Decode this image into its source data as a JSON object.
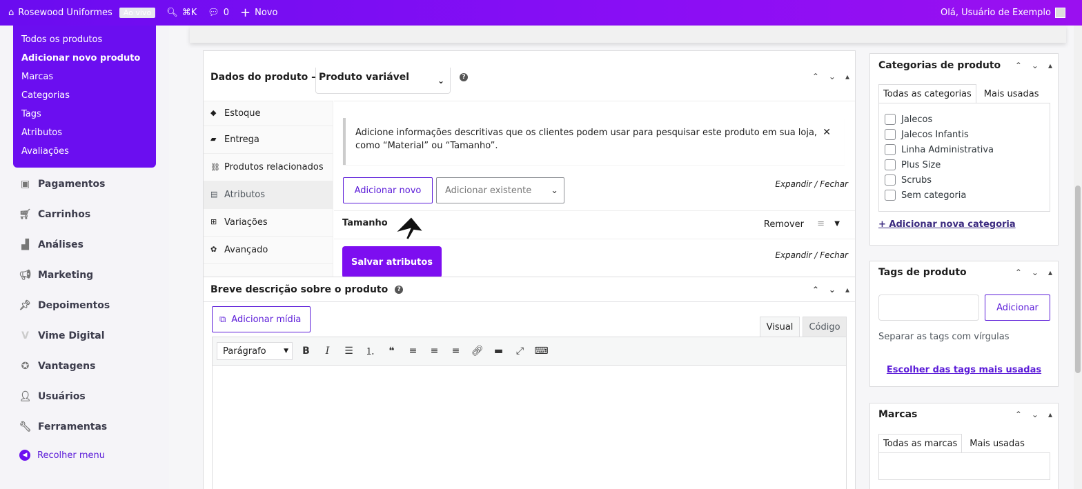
{
  "adminbar": {
    "site_name": "Rosewood Uniformes",
    "live_badge": "Ao vivo",
    "search_shortcut": "⌘K",
    "comments_count": "0",
    "new_label": "Novo",
    "greeting": "Olá, Usuário de Exemplo"
  },
  "sidebar": {
    "submenu": [
      "Todos os produtos",
      "Adicionar novo produto",
      "Marcas",
      "Categorias",
      "Tags",
      "Atributos",
      "Avaliações"
    ],
    "items": [
      {
        "label": "Pagamentos",
        "icon": "payments-icon",
        "glyph": "$"
      },
      {
        "label": "Carrinhos",
        "icon": "cart-icon",
        "glyph": "🛒"
      },
      {
        "label": "Análises",
        "icon": "chart-bar-icon",
        "glyph": "▮"
      },
      {
        "label": "Marketing",
        "icon": "megaphone-icon",
        "glyph": "📢"
      },
      {
        "label": "Depoimentos",
        "icon": "pin-icon",
        "glyph": "📌"
      },
      {
        "label": "Vime Digital",
        "icon": "vime-logo-icon",
        "glyph": "V"
      },
      {
        "label": "Vantagens",
        "icon": "badge-icon",
        "glyph": "✪"
      },
      {
        "label": "Usuários",
        "icon": "user-icon",
        "glyph": "👤"
      },
      {
        "label": "Ferramentas",
        "icon": "wrench-icon",
        "glyph": "🔧"
      }
    ],
    "collapse_label": "Recolher menu"
  },
  "product_data": {
    "title": "Dados do produto —",
    "type_select": "Produto variável",
    "tabs": [
      {
        "label": "Estoque",
        "glyph": "◆"
      },
      {
        "label": "Entrega",
        "glyph": "▰"
      },
      {
        "label": "Produtos relacionados",
        "glyph": "🔗"
      },
      {
        "label": "Atributos",
        "glyph": "▤"
      },
      {
        "label": "Variações",
        "glyph": "⊞"
      },
      {
        "label": "Avançado",
        "glyph": "✿"
      }
    ],
    "notice": "Adicione informações descritivas que os clientes podem usar para pesquisar este produto em sua loja, como “Material” ou “Tamanho”.",
    "add_new_label": "Adicionar novo",
    "add_existing_placeholder": "Adicionar existente",
    "expand_label": "Expandir",
    "separator": "/",
    "close_label": "Fechar",
    "attribute_name": "Tamanho",
    "remove_label": "Remover",
    "save_label": "Salvar atributos"
  },
  "short_description": {
    "title": "Breve descrição sobre o produto",
    "add_media_label": "Adicionar mídia",
    "tab_visual": "Visual",
    "tab_code": "Código",
    "format_select": "Parágrafo"
  },
  "categories": {
    "title": "Categorias de produto",
    "tab_all": "Todas as categorias",
    "tab_most_used": "Mais usadas",
    "items": [
      "Jalecos",
      "Jalecos Infantis",
      "Linha Administrativa",
      "Plus Size",
      "Scrubs",
      "Sem categoria"
    ],
    "add_link": "+ Adicionar nova categoria"
  },
  "tags": {
    "title": "Tags de produto",
    "add_button": "Adicionar",
    "help": "Separar as tags com vírgulas",
    "choose_link": "Escolher das tags mais usadas"
  },
  "brands": {
    "title": "Marcas",
    "tab_all": "Todas as marcas",
    "tab_most_used": "Mais usadas"
  },
  "colors": {
    "brand": "#6b0ef0",
    "accent_text": "#5a1ad8",
    "button": "#7d0ef0"
  }
}
